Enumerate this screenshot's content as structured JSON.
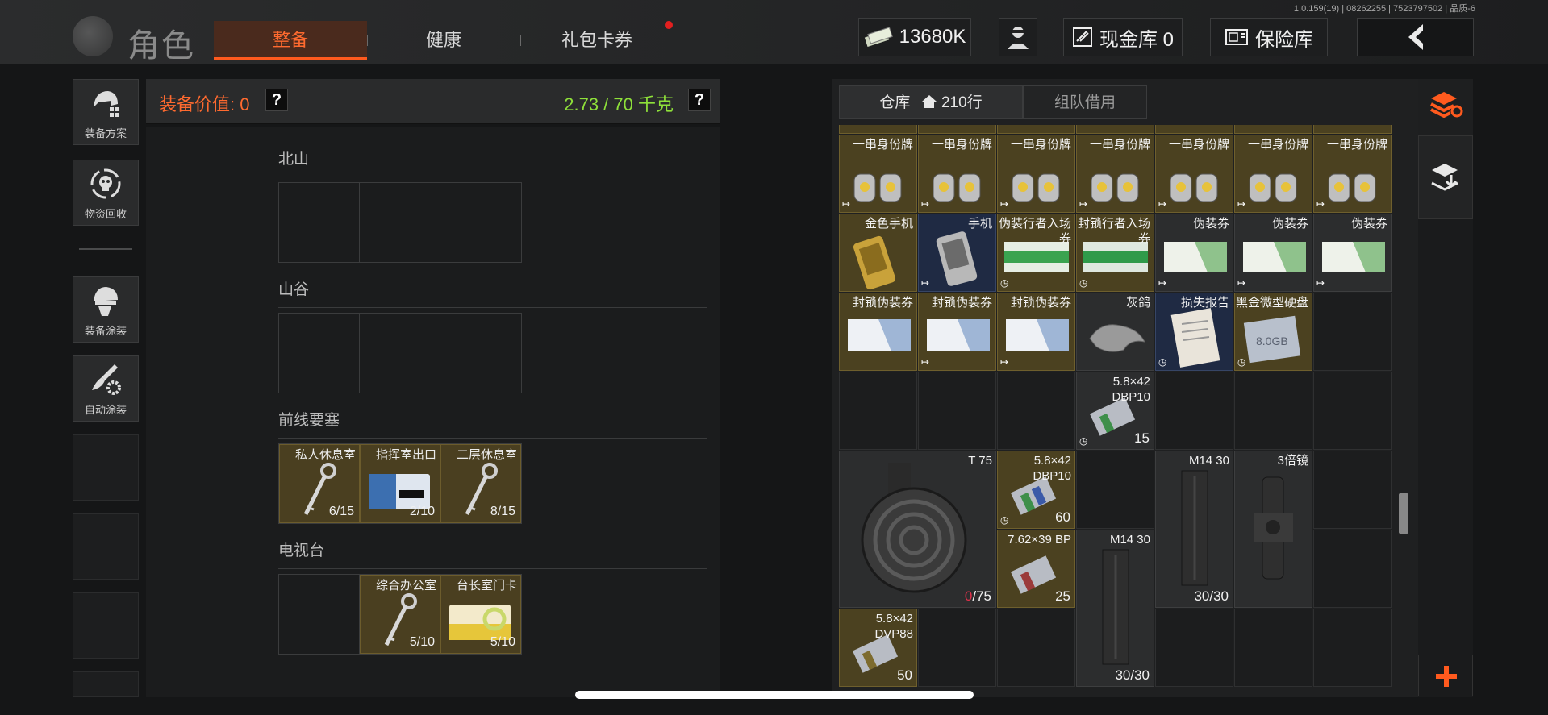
{
  "version": "1.0.159(19) | 08262255 | 7523797502 | 品质-6",
  "header": {
    "title": "角色",
    "tabs": [
      {
        "label": "整备",
        "active": true
      },
      {
        "label": "健康",
        "active": false
      },
      {
        "label": "礼包卡券",
        "active": false,
        "badge": true
      }
    ],
    "money": "13680K",
    "cash_vault": "现金库 0",
    "safe": "保险库",
    "back_label": "<"
  },
  "sidebar": {
    "buttons": [
      {
        "label": "装备方案",
        "icon": "helmet-gear-icon"
      },
      {
        "label": "物资回收",
        "icon": "recycle-skull-icon"
      },
      {
        "label": "装备涂装",
        "icon": "paint-helmet-icon"
      },
      {
        "label": "自动涂装",
        "icon": "paint-brush-gear-icon"
      }
    ]
  },
  "equipment": {
    "value_label": "装备价值: 0",
    "weight_label": "2.73 / 70 千克",
    "help": "?"
  },
  "key_sections": [
    {
      "name": "北山",
      "slots": [
        {},
        {},
        {}
      ]
    },
    {
      "name": "山谷",
      "slots": [
        {},
        {},
        {}
      ]
    },
    {
      "name": "前线要塞",
      "slots": [
        {
          "name": "私人休息室",
          "count": "6/15",
          "art": "key"
        },
        {
          "name": "指挥室出口",
          "count": "2/10",
          "art": "card-blue"
        },
        {
          "name": "二层休息室",
          "count": "8/15",
          "art": "key"
        }
      ]
    },
    {
      "name": "电视台",
      "slots": [
        {},
        {
          "name": "综合办公室",
          "count": "5/10",
          "art": "key"
        },
        {
          "name": "台长室门卡",
          "count": "5/10",
          "art": "card-yellow"
        }
      ]
    }
  ],
  "storage": {
    "tabs": [
      {
        "label": "仓库",
        "rows": "210行",
        "active": true
      },
      {
        "label": "组队借用",
        "active": false
      }
    ],
    "row1": [
      {
        "name": "一串身份牌"
      },
      {
        "name": "一串身份牌"
      },
      {
        "name": "一串身份牌"
      },
      {
        "name": "一串身份牌"
      },
      {
        "name": "一串身份牌"
      },
      {
        "name": "一串身份牌"
      },
      {
        "name": "一串身份牌"
      }
    ],
    "row2": [
      {
        "name": "金色手机"
      },
      {
        "name": "手机"
      },
      {
        "name": "伪装行者入场券"
      },
      {
        "name": "封锁行者入场券"
      },
      {
        "name": "伪装券"
      },
      {
        "name": "伪装券"
      },
      {
        "name": "伪装券"
      }
    ],
    "row3": [
      {
        "name": "封锁伪装券"
      },
      {
        "name": "封锁伪装券"
      },
      {
        "name": "封锁伪装券"
      },
      {
        "name": "灰鸽"
      },
      {
        "name": "损失报告"
      },
      {
        "name": "黑金微型硬盘"
      }
    ],
    "ammo1": {
      "name": "5.8×42 DBP10",
      "count": "15"
    },
    "drum": {
      "name": "T 75",
      "count_zero": "0",
      "count_rest": "/75"
    },
    "ammo2": {
      "name": "5.8×42 DBP10",
      "count": "60"
    },
    "ammo3": {
      "name": "7.62×39 BP",
      "count": "25"
    },
    "mag1": {
      "name": "M14 30",
      "count": "30/30"
    },
    "mag2": {
      "name": "M14 30",
      "count": "30/30"
    },
    "scope": {
      "name": "3倍镜"
    },
    "ammo4": {
      "name": "5.8×42 DVP88",
      "count": "50"
    }
  },
  "colors": {
    "accent": "#ff5a1e",
    "gold_cell": "#4b4120",
    "weight_green": "#8ee03a"
  }
}
